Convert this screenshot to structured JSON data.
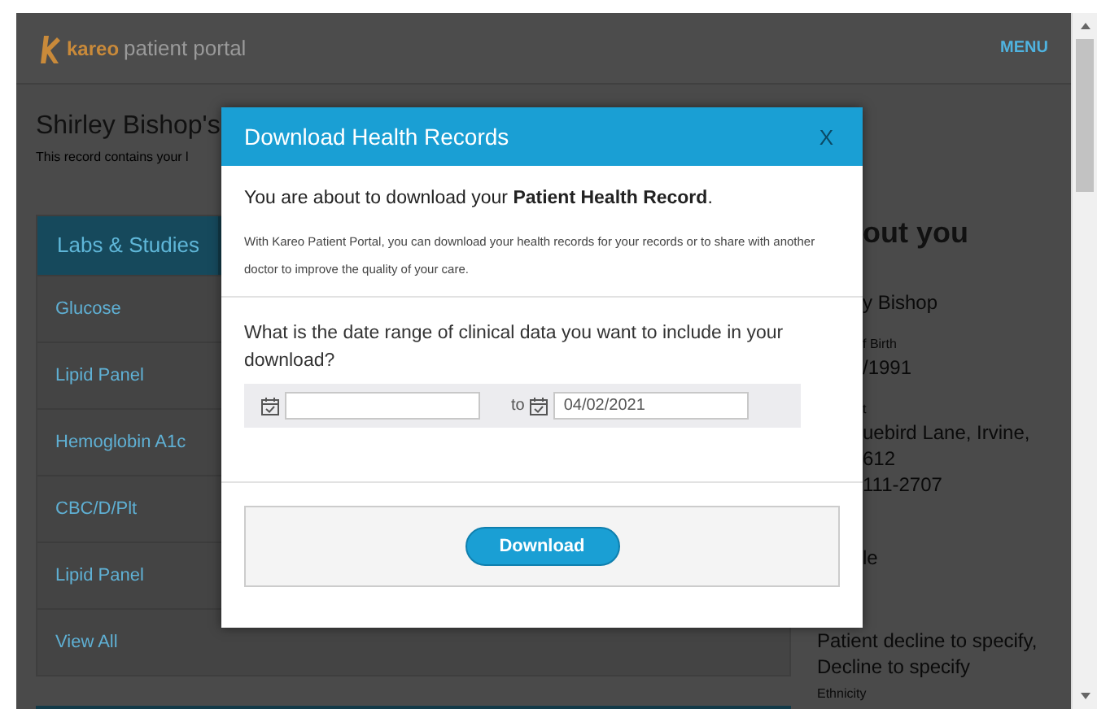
{
  "header": {
    "brand": "kareo",
    "product": "patient portal",
    "menu": "MENU"
  },
  "page": {
    "title": "Shirley Bishop's",
    "subtitle": "This record contains your l"
  },
  "labs": {
    "tab": "Labs & Studies",
    "items": [
      "Glucose",
      "Lipid Panel",
      "Hemoglobin A1c",
      "CBC/D/Plt",
      "Lipid Panel",
      "View All"
    ]
  },
  "about": {
    "heading": "out you",
    "partial_lines": [
      {
        "kind": "value",
        "text": "y Bishop"
      },
      {
        "kind": "label",
        "text": "f Birth"
      },
      {
        "kind": "value",
        "text": "/1991"
      },
      {
        "kind": "label",
        "text": "t"
      },
      {
        "kind": "value",
        "text": "uebird Lane, Irvine,"
      },
      {
        "kind": "value",
        "text": "612"
      },
      {
        "kind": "value",
        "text": "111-2707"
      },
      {
        "kind": "gap"
      },
      {
        "kind": "value",
        "text": "le"
      }
    ],
    "lines": [
      {
        "kind": "value",
        "text": "Patient decline to specify,"
      },
      {
        "kind": "value",
        "text": "Decline to specify"
      },
      {
        "kind": "label",
        "text": "Ethnicity"
      }
    ]
  },
  "modal": {
    "title": "Download Health Records",
    "close": "X",
    "intro": "You are about to download your **Patient Health Record**.",
    "note": "With Kareo Patient Portal, you can download your health records for your records or to share with another doctor to improve the quality of your care.",
    "question": "What is the date range of clinical data you want to include in your download?",
    "to_label": "to",
    "to_value": "04/02/2021",
    "button": "Download"
  }
}
